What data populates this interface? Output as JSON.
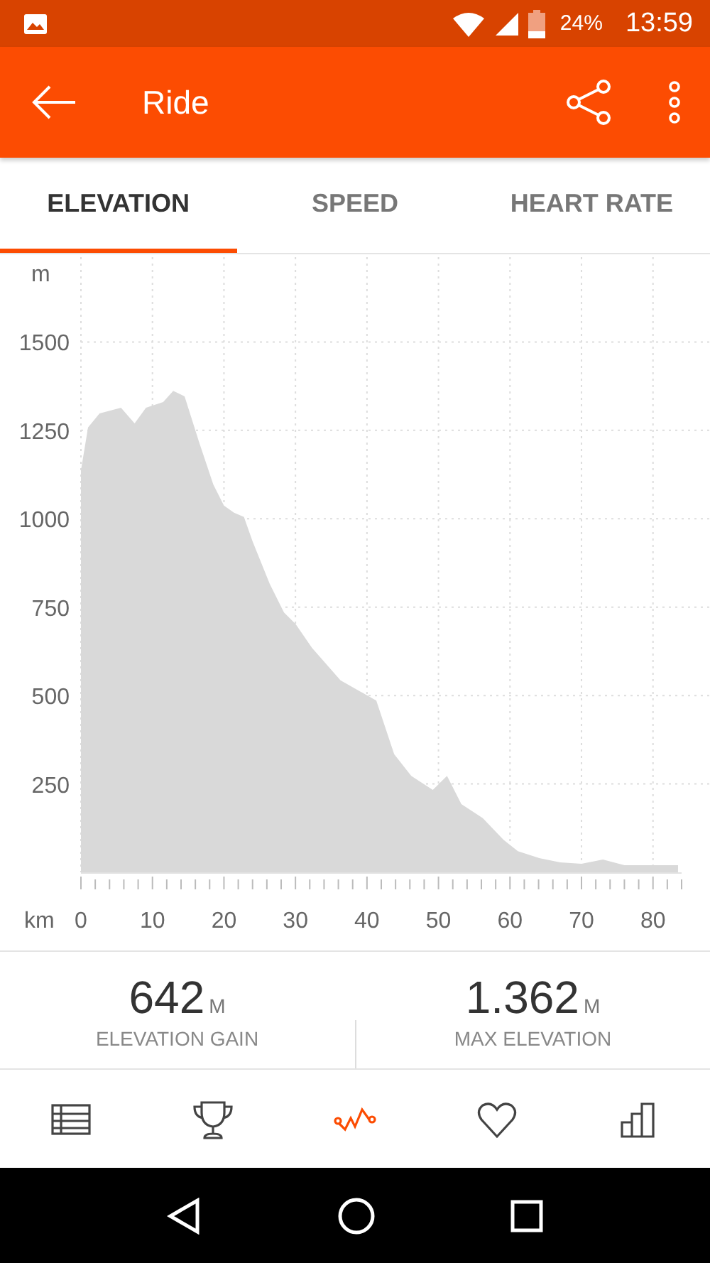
{
  "status_bar": {
    "battery_text": "24%",
    "time": "13:59"
  },
  "app_bar": {
    "title": "Ride"
  },
  "tabs": [
    {
      "label": "ELEVATION",
      "selected": true
    },
    {
      "label": "SPEED",
      "selected": false
    },
    {
      "label": "HEART RATE",
      "selected": false
    }
  ],
  "chart": {
    "y_unit": "m",
    "x_unit": "km",
    "chart_data": {
      "type": "area",
      "grid": true,
      "xlim": [
        0,
        84
      ],
      "ylim": [
        0,
        1740
      ],
      "xticks": [
        0,
        10,
        20,
        30,
        40,
        50,
        60,
        70,
        80
      ],
      "yticks": [
        250,
        500,
        750,
        1000,
        1250,
        1500
      ],
      "x": [
        0,
        1,
        2.6,
        5.6,
        7.5,
        9.1,
        11.5,
        12.9,
        14.5,
        16.5,
        18.5,
        20,
        21.4,
        22.8,
        24,
        26.4,
        28.4,
        30,
        32.3,
        36.3,
        41.3,
        43.8,
        46.2,
        49.2,
        51.2,
        53.2,
        56.2,
        59.1,
        61.1,
        64.1,
        67,
        70,
        73,
        76,
        83.5
      ],
      "series": [
        {
          "color": "#d9d9d9",
          "values": [
            1137,
            1258,
            1298,
            1314,
            1270,
            1314,
            1330,
            1362,
            1346,
            1218,
            1097,
            1037,
            1017,
            1005,
            936,
            816,
            735,
            703,
            635,
            543,
            486,
            334,
            273,
            233,
            273,
            193,
            153,
            92,
            60,
            40,
            28,
            24,
            36,
            20,
            20
          ]
        }
      ]
    }
  },
  "stats": [
    {
      "value": "642",
      "unit": "M",
      "label": "ELEVATION GAIN"
    },
    {
      "value": "1.362",
      "unit": "M",
      "label": "MAX ELEVATION"
    }
  ],
  "bottom_nav": [
    {
      "kind": "table",
      "selected": false
    },
    {
      "kind": "trophy",
      "selected": false
    },
    {
      "kind": "wave",
      "selected": true
    },
    {
      "kind": "heart",
      "selected": false
    },
    {
      "kind": "bars",
      "selected": false
    }
  ]
}
